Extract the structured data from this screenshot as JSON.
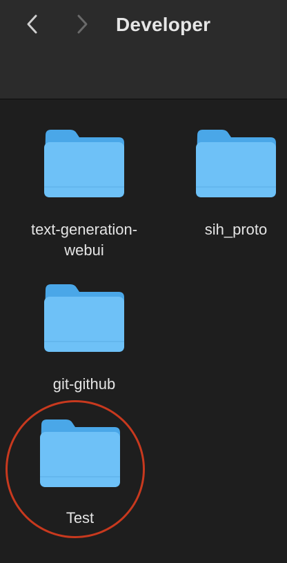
{
  "window": {
    "title": "Developer"
  },
  "toolbar": {
    "back_icon": "chevron-left-icon",
    "forward_icon": "chevron-right-icon"
  },
  "colors": {
    "folder_body": "#6ec1f7",
    "folder_tab": "#4aa7e8",
    "annotation_ring": "#c8391e"
  },
  "items": [
    {
      "label_line1": "text-generation-",
      "label_line2": "webui",
      "icon": "folder-icon"
    },
    {
      "label_line1": "sih_proto",
      "label_line2": "",
      "icon": "folder-icon"
    },
    {
      "label_line1": "git-github",
      "label_line2": "",
      "icon": "folder-icon"
    },
    {
      "label_line1": "Test",
      "label_line2": "",
      "icon": "folder-icon"
    }
  ]
}
